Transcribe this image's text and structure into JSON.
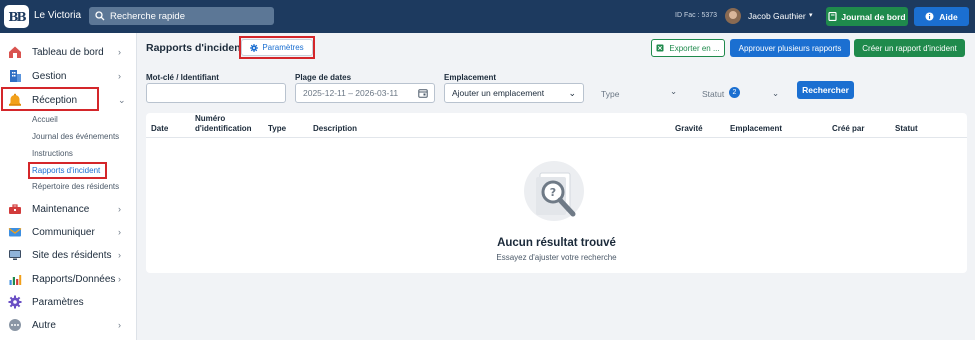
{
  "topbar": {
    "app_name": "Le Victoria",
    "search_placeholder": "Recherche rapide",
    "fac_id": "ID Fac : 5373",
    "user_name": "Jacob Gauthier",
    "journal_label": "Journal de bord",
    "aide_label": "Aide"
  },
  "sidebar": {
    "items": [
      {
        "label": "Tableau de bord",
        "icon": "dashboard-icon"
      },
      {
        "label": "Gestion",
        "icon": "building-icon"
      },
      {
        "label": "Réception",
        "icon": "bell-icon"
      },
      {
        "label": "Maintenance",
        "icon": "toolbox-icon"
      },
      {
        "label": "Communiquer",
        "icon": "envelope-icon"
      },
      {
        "label": "Site des résidents",
        "icon": "monitor-icon"
      },
      {
        "label": "Rapports/Données",
        "icon": "chart-icon"
      },
      {
        "label": "Paramètres",
        "icon": "gear-icon"
      },
      {
        "label": "Autre",
        "icon": "more-icon"
      }
    ],
    "subitems": [
      {
        "label": "Accueil"
      },
      {
        "label": "Journal des événements"
      },
      {
        "label": "Instructions"
      },
      {
        "label": "Rapports d'incident"
      },
      {
        "label": "Répertoire des résidents"
      }
    ]
  },
  "header": {
    "title": "Rapports d'incident",
    "params_label": "Paramètres",
    "export_label": "Exporter en ...",
    "approve_label": "Approuver plusieurs rapports",
    "create_label": "Créer un rapport d'incident"
  },
  "filters": {
    "keyword_label": "Mot-clé / Identifiant",
    "keyword_value": "",
    "dates_label": "Plage de dates",
    "dates_value": "2025-12-11 – 2026-03-11",
    "location_label": "Emplacement",
    "location_value": "Ajouter un emplacement",
    "type_label": "Type",
    "status_label": "Statut",
    "status_count": "2",
    "search_label": "Rechercher"
  },
  "table": {
    "columns": [
      "Date",
      "Numéro d'identification",
      "Type",
      "Description",
      "Gravité",
      "Emplacement",
      "Créé par",
      "Statut"
    ],
    "empty_title": "Aucun résultat trouvé",
    "empty_subtitle": "Essayez d'ajuster votre recherche"
  },
  "colors": {
    "topbar": "#1d3a5f",
    "primary": "#1b6fd1",
    "success": "#1f8a4c",
    "highlight": "#d4262a"
  }
}
